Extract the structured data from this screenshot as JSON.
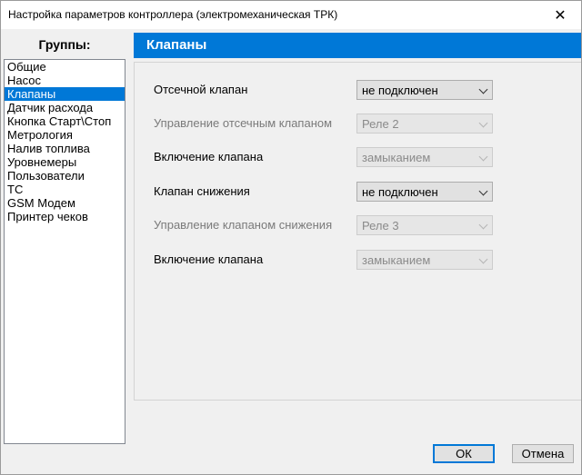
{
  "window": {
    "title": "Настройка параметров контроллера (электромеханическая ТРК)",
    "close_glyph": "✕"
  },
  "groups": {
    "header": "Группы:",
    "items": [
      {
        "label": "Общие"
      },
      {
        "label": "Насос"
      },
      {
        "label": "Клапаны"
      },
      {
        "label": "Датчик расхода"
      },
      {
        "label": "Кнопка Старт\\Стоп"
      },
      {
        "label": "Метрология"
      },
      {
        "label": "Налив топлива"
      },
      {
        "label": "Уровнемеры"
      },
      {
        "label": "Пользователи"
      },
      {
        "label": "ТС"
      },
      {
        "label": "GSM Модем"
      },
      {
        "label": "Принтер чеков"
      }
    ],
    "selected": "Клапаны"
  },
  "panel": {
    "title": "Клапаны",
    "rows": [
      {
        "label": "Отсечной клапан",
        "value": "не подключен",
        "enabled": true
      },
      {
        "label": "Управление  отсечным клапаном",
        "value": "Реле 2",
        "enabled": false
      },
      {
        "label": "Включение клапана",
        "value": "замыканием",
        "enabled": false
      },
      {
        "label": "Клапан снижения",
        "value": "не подключен",
        "enabled": true
      },
      {
        "label": "Управление  клапаном снижения",
        "value": "Реле 3",
        "enabled": false
      },
      {
        "label": "Включение клапана",
        "value": "замыканием",
        "enabled": false
      }
    ]
  },
  "buttons": {
    "ok": "ОК",
    "cancel": "Отмена"
  }
}
